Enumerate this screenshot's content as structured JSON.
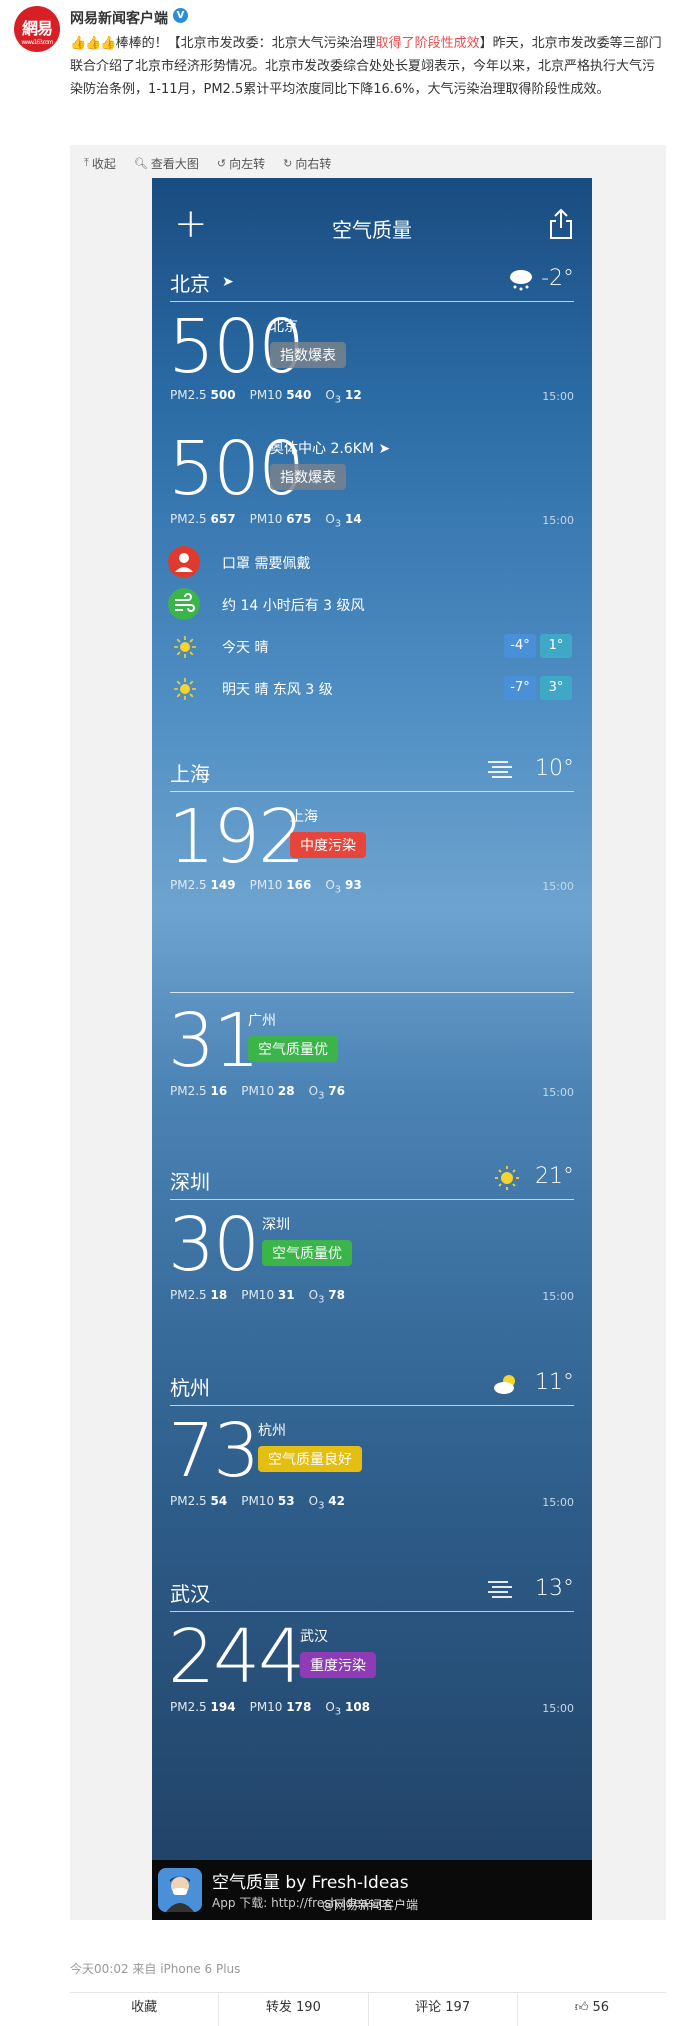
{
  "post": {
    "username": "网易新闻客户端",
    "avatar_text": "網易",
    "avatar_sub": "www.163.com",
    "thumbs": "👍👍👍",
    "text_part1": "棒棒的！【北京市发改委：北京大气污染治理",
    "text_highlight": "取得了阶段性成效",
    "text_part2": "】昨天，北京市发改委等三部门联合介绍了北京市经济形势情况。北京市发改委综合处处长夏翊表示，今年以来，北京严格执行大气污染防治条例，1-11月，PM2.5累计平均浓度同比下降16.6%，大气污染治理取得阶段性成效。",
    "meta": "今天00:02 来自 iPhone 6 Plus"
  },
  "image_toolbar": {
    "collapse": "收起",
    "view_large": "查看大图",
    "rotate_left": "向左转",
    "rotate_right": "向右转"
  },
  "app": {
    "title": "空气质量",
    "tips": {
      "mask": "口罩 需要佩戴",
      "wind": "约 14 小时后有 3 级风",
      "today": "今天 晴",
      "today_low": "-4°",
      "today_high": "1°",
      "tomorrow": "明天 晴 东风 3 级",
      "tomorrow_low": "-7°",
      "tomorrow_high": "3°"
    },
    "cities": {
      "beijing": {
        "name": "北京",
        "temp": "-2°",
        "s1": {
          "aqi": "500",
          "place": "北京",
          "badge": "指数爆表",
          "pm25": "500",
          "pm10": "540",
          "o3": "12",
          "time": "15:00"
        },
        "s2": {
          "aqi": "500",
          "place": "奥体中心 2.6KM",
          "badge": "指数爆表",
          "pm25": "657",
          "pm10": "675",
          "o3": "14",
          "time": "15:00"
        }
      },
      "shanghai": {
        "name": "上海",
        "temp": "10°",
        "aqi": "192",
        "place": "上海",
        "badge": "中度污染",
        "pm25": "149",
        "pm10": "166",
        "o3": "93",
        "time": "15:00"
      },
      "guangzhou": {
        "aqi": "31",
        "place": "广州",
        "badge": "空气质量优",
        "pm25": "16",
        "pm10": "28",
        "o3": "76",
        "time": "15:00"
      },
      "shenzhen": {
        "name": "深圳",
        "temp": "21°",
        "aqi": "30",
        "place": "深圳",
        "badge": "空气质量优",
        "pm25": "18",
        "pm10": "31",
        "o3": "78",
        "time": "15:00"
      },
      "hangzhou": {
        "name": "杭州",
        "temp": "11°",
        "aqi": "73",
        "place": "杭州",
        "badge": "空气质量良好",
        "pm25": "54",
        "pm10": "53",
        "o3": "42",
        "time": "15:00"
      },
      "wuhan": {
        "name": "武汉",
        "temp": "13°",
        "aqi": "244",
        "place": "武汉",
        "badge": "重度污染",
        "pm25": "194",
        "pm10": "178",
        "o3": "108",
        "time": "15:00"
      }
    },
    "labels": {
      "pm25": "PM2.5",
      "pm10": "PM10",
      "o3": "O",
      "o3_sub": "3"
    },
    "footer": {
      "title": "空气质量 by Fresh-Ideas",
      "sub": "App 下载: http://fresh-ideas.cc",
      "watermark": "@网易新闻客户端"
    }
  },
  "actions": {
    "favorite": "收藏",
    "repost": "转发 190",
    "comment": "评论 197",
    "like": "56"
  },
  "colors": {
    "highlight": "#eb4c4c",
    "badge_gray": "#78828c",
    "badge_red": "#e5453a",
    "badge_green": "#3bb54a",
    "badge_yellow": "#e4be10",
    "badge_purple": "#8e3bb5"
  },
  "icons": [
    "thumbs-up-icon",
    "verified-icon",
    "collapse-icon",
    "zoom-icon",
    "rotate-left-icon",
    "rotate-right-icon",
    "plus-icon",
    "share-icon",
    "location-arrow-icon",
    "snow-cloud-icon",
    "mask-icon",
    "wind-icon",
    "sun-icon",
    "haze-icon",
    "partly-cloudy-icon",
    "like-icon"
  ]
}
